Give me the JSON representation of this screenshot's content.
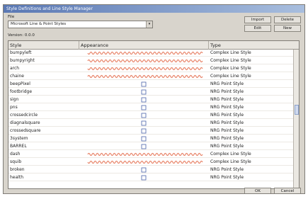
{
  "window": {
    "title": "Style Definitions and Line Style Manager"
  },
  "file": {
    "label": "File",
    "value": "Microsoft Line & Point Styles",
    "arrow": "▾"
  },
  "buttons": {
    "import": "Import",
    "delete": "Delete",
    "edit": "Edit",
    "new": "New",
    "ok": "OK",
    "cancel": "Cancel"
  },
  "version_text": "Version: 0.0.0",
  "columns": {
    "style": "Style",
    "appearance": "Appearance",
    "type": "Type"
  },
  "rows": [
    {
      "style": "bumpyleft",
      "type": "Complex Line Style",
      "kind": "line",
      "color": "#e8856a"
    },
    {
      "style": "bumpyright",
      "type": "Complex Line Style",
      "kind": "line",
      "color": "#e8856a"
    },
    {
      "style": "arch",
      "type": "Complex Line Style",
      "kind": "line",
      "color": "#e8856a"
    },
    {
      "style": "chaine",
      "type": "Complex Line Style",
      "kind": "line",
      "color": "#e8856a"
    },
    {
      "style": "beepPixel",
      "type": "NRG Point Style",
      "kind": "point"
    },
    {
      "style": "footbridge",
      "type": "NRG Point Style",
      "kind": "point"
    },
    {
      "style": "sign",
      "type": "NRG Point Style",
      "kind": "point"
    },
    {
      "style": "pns",
      "type": "NRG Point Style",
      "kind": "point"
    },
    {
      "style": "crossedcircle",
      "type": "NRG Point Style",
      "kind": "point"
    },
    {
      "style": "diagnalsquare",
      "type": "NRG Point Style",
      "kind": "point"
    },
    {
      "style": "crossedsquare",
      "type": "NRG Point Style",
      "kind": "point"
    },
    {
      "style": "3system",
      "type": "NRG Point Style",
      "kind": "point"
    },
    {
      "style": "BARREL",
      "type": "NRG Point Style",
      "kind": "point"
    },
    {
      "style": "dash",
      "type": "Complex Line Style",
      "kind": "line",
      "color": "#e8856a"
    },
    {
      "style": "squib",
      "type": "Complex Line Style",
      "kind": "line",
      "color": "#e8856a"
    },
    {
      "style": "broken",
      "type": "NRG Point Style",
      "kind": "point"
    },
    {
      "style": "health",
      "type": "NRG Point Style",
      "kind": "point"
    }
  ],
  "colors": {
    "titlebar_start": "#5a78b4",
    "line_sample": "#e8856a",
    "point_sample": "#4a62a8"
  }
}
